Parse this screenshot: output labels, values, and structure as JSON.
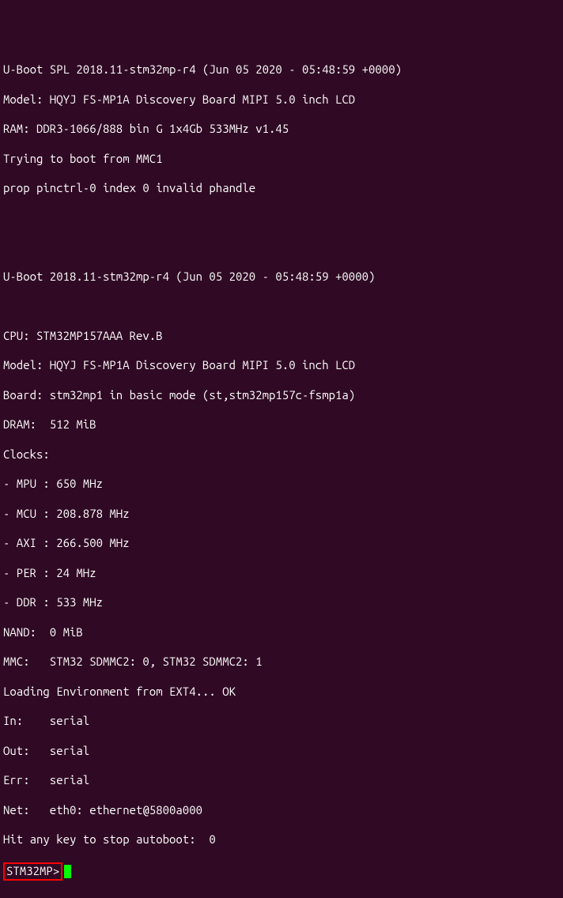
{
  "lines": {
    "l0": "U-Boot SPL 2018.11-stm32mp-r4 (Jun 05 2020 - 05:48:59 +0000)",
    "l1": "Model: HQYJ FS-MP1A Discovery Board MIPI 5.0 inch LCD",
    "l2": "RAM: DDR3-1066/888 bin G 1x4Gb 533MHz v1.45",
    "l3": "Trying to boot from MMC1",
    "l4": "prop pinctrl-0 index 0 invalid phandle",
    "l5": "",
    "l6": "",
    "l7": "U-Boot 2018.11-stm32mp-r4 (Jun 05 2020 - 05:48:59 +0000)",
    "l8": "",
    "l9": "CPU: STM32MP157AAA Rev.B",
    "l10": "Model: HQYJ FS-MP1A Discovery Board MIPI 5.0 inch LCD",
    "l11": "Board: stm32mp1 in basic mode (st,stm32mp157c-fsmp1a)",
    "l12": "DRAM:  512 MiB",
    "l13": "Clocks:",
    "l14": "- MPU : 650 MHz",
    "l15": "- MCU : 208.878 MHz",
    "l16": "- AXI : 266.500 MHz",
    "l17": "- PER : 24 MHz",
    "l18": "- DDR : 533 MHz",
    "l19": "NAND:  0 MiB",
    "l20": "MMC:   STM32 SDMMC2: 0, STM32 SDMMC2: 1",
    "l21": "Loading Environment from EXT4... OK",
    "l22": "In:    serial",
    "l23": "Out:   serial",
    "l24": "Err:   serial",
    "l25": "Net:   eth0: ethernet@5800a000",
    "l26": "Hit any key to stop autoboot:  0 "
  },
  "prompt": "STM32MP>"
}
